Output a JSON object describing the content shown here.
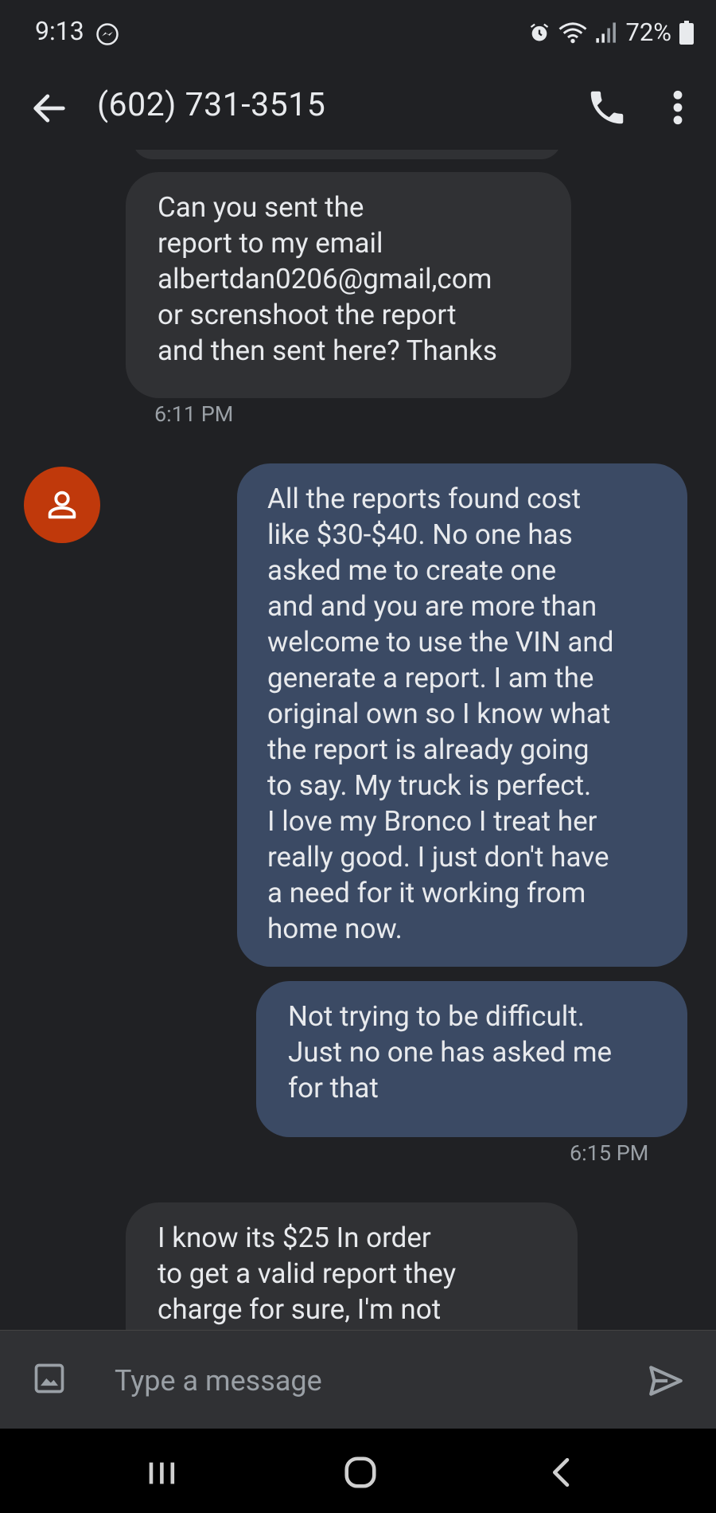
{
  "status": {
    "time": "9:13",
    "battery": "72%"
  },
  "header": {
    "title": "(602) 731-3515"
  },
  "messages": [
    {
      "direction": "incoming",
      "text": "Can you sent the\nreport to my email\nalbertdan0206@gmail,com\nor screnshoot the report\nand then sent here? Thanks",
      "time": "6:11 PM"
    },
    {
      "direction": "outgoing",
      "text": "All the reports found cost\nlike $30-$40.   No one has\nasked me to create one\nand and you are more than\nwelcome to use the VIN and\ngenerate a report.  I am the\noriginal own so I know what\nthe report is already going\nto say.  My truck is perfect.\nI love my Bronco I treat her\nreally good. I just don't have\na need for it working from\nhome now."
    },
    {
      "direction": "outgoing",
      "text": "Not trying to be difficult.\nJust no one has asked me\nfor that",
      "time": "6:15 PM"
    },
    {
      "direction": "incoming",
      "text": "I know its $25 In order\nto get a valid report they\ncharge for sure, I'm not"
    }
  ],
  "composer": {
    "placeholder": "Type a message"
  },
  "icons": {
    "status_left": "messenger-icon",
    "back": "arrow-back-icon",
    "call": "phone-icon",
    "more": "more-vert-icon",
    "avatar": "person-icon",
    "attach": "image-icon",
    "send": "send-icon"
  },
  "colors": {
    "background": "#202124",
    "incoming_bubble": "#303134",
    "outgoing_bubble": "#3b4a64",
    "avatar": "#c0390b"
  }
}
